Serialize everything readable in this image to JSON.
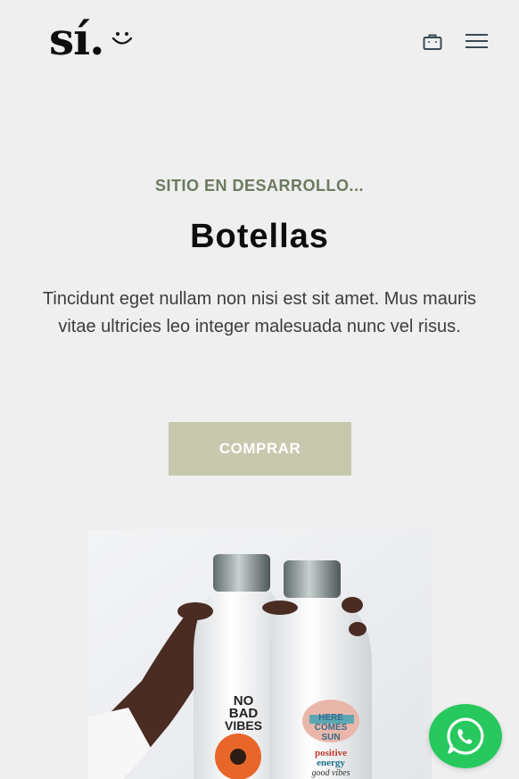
{
  "header": {
    "logo_text": "sí.",
    "cart_icon": "shopping-bag-icon",
    "menu_icon": "hamburger-menu-icon"
  },
  "hero": {
    "eyebrow": "SITIO EN DESARROLLO...",
    "title": "Botellas",
    "description": "Tincidunt eget nullam non nisi est sit amet. Mus mauris vitae ultricies leo integer malesuada nunc vel risus.",
    "cta_label": "COMPRAR"
  },
  "product_image": {
    "bottle_left_text": [
      "NO",
      "BAD",
      "VIBES"
    ],
    "bottle_right_text": [
      "HERE",
      "COMES",
      "SUN",
      "positive",
      "energy",
      "good vibes"
    ]
  },
  "floating": {
    "whatsapp_icon": "whatsapp-icon"
  },
  "colors": {
    "background": "#efefef",
    "eyebrow": "#6b7a5e",
    "button": "#c8c8ae",
    "whatsapp": "#27c85d"
  }
}
